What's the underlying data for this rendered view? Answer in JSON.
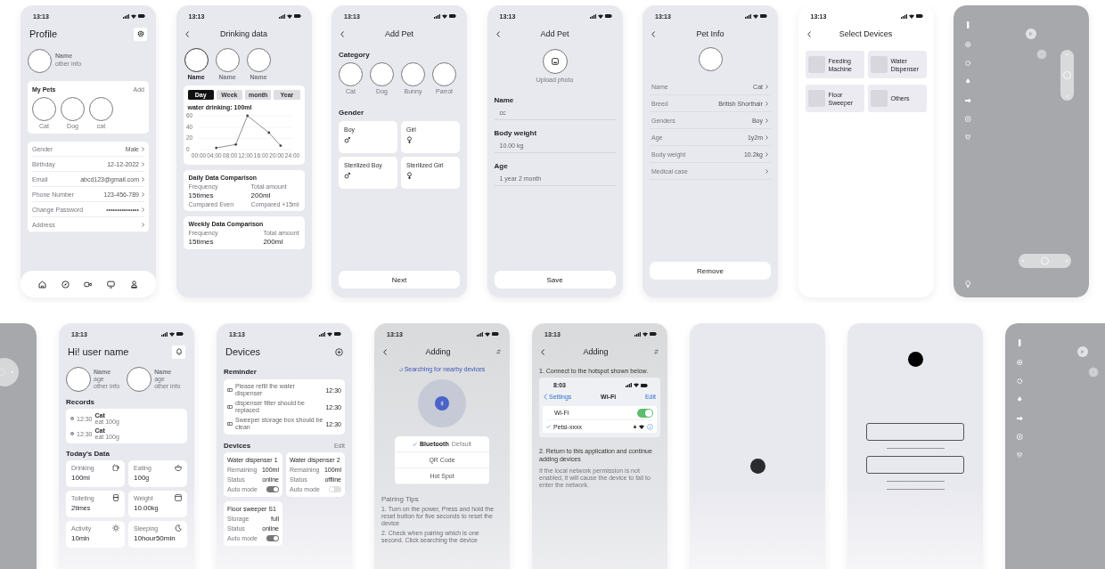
{
  "rows": [
    {
      "screens": [
        {
          "kind": "profile",
          "time": "13:13",
          "title": "Profile",
          "user": {
            "name": "Name",
            "info": "other info"
          },
          "pets": {
            "title": "My Pets",
            "action": "Add",
            "items": [
              "Cat",
              "Dog",
              "cat"
            ]
          },
          "fields": [
            {
              "label": "Gender",
              "value": "Male"
            },
            {
              "label": "Birthday",
              "value": "12-12-2022"
            },
            {
              "label": "Email",
              "value": "abcd123@gmail.com"
            },
            {
              "label": "Phone Number",
              "value": "123-456-789"
            },
            {
              "label": "Change Password",
              "value": "•••••••••••••••"
            },
            {
              "label": "Address"
            }
          ]
        },
        {
          "kind": "drinking",
          "time": "13:13",
          "title": "Drinking data",
          "pets": [
            {
              "name": "Name",
              "selected": true
            },
            {
              "name": "Name",
              "selected": false
            },
            {
              "name": "Name",
              "selected": false
            }
          ],
          "periods": [
            {
              "label": "Day",
              "selected": true
            },
            {
              "label": "Week",
              "selected": false
            },
            {
              "label": "month",
              "selected": false
            },
            {
              "label": "Year",
              "selected": false
            }
          ],
          "chart_data": {
            "type": "line",
            "title": "water drinking: 100ml",
            "x": [
              4.5,
              9.5,
              12.5,
              18,
              21
            ],
            "series": [
              {
                "color": "#444444",
                "values": [
                  3,
                  9,
                  60,
                  30,
                  7
                ]
              }
            ],
            "xlim": [
              0,
              24
            ],
            "ylim": [
              0,
              60
            ],
            "xticks": [
              {
                "value": 0,
                "label": "00:00"
              },
              {
                "value": 4,
                "label": "04:00"
              },
              {
                "value": 8,
                "label": "08:00"
              },
              {
                "value": 12,
                "label": "12:00"
              },
              {
                "value": 16,
                "label": "16:00"
              },
              {
                "value": 20,
                "label": "20:00"
              },
              {
                "value": 24,
                "label": "24:00"
              }
            ],
            "yticks": [
              0,
              20,
              40,
              60
            ]
          },
          "comparisons": [
            {
              "title": "Daily Data Comparison",
              "left_label": "Frequency",
              "left_value": "15times",
              "left_note": "Compared  Even",
              "right_label": "Total amount",
              "right_value": "200ml",
              "right_note": "Compared  +15ml"
            },
            {
              "title": "Weekly Data Comparison",
              "left_label": "Frequency",
              "left_value": "15times",
              "right_label": "Total amount",
              "right_value": "200ml"
            }
          ]
        },
        {
          "kind": "add_pet_category",
          "time": "13:13",
          "title": "Add Pet",
          "category_title": "Category",
          "categories": [
            "Cat",
            "Dog",
            "Bunny",
            "Parrot"
          ],
          "gender_title": "Gender",
          "genders": [
            {
              "label": "Boy",
              "kind": "male",
              "sterilized": false
            },
            {
              "label": "Girl",
              "kind": "female",
              "sterilized": false
            },
            {
              "label": "Sterilized Boy",
              "kind": "male",
              "sterilized": true
            },
            {
              "label": "Sterilized Girl",
              "kind": "female",
              "sterilized": true
            }
          ],
          "button": "Next"
        },
        {
          "kind": "add_pet_form",
          "time": "13:13",
          "title": "Add Pet",
          "upload": "Upload photo",
          "fields": [
            {
              "label": "Name",
              "value": "cc"
            },
            {
              "label": "Body weight",
              "value": "10.00 kg"
            },
            {
              "label": "Age",
              "value": "1 year 2 month"
            }
          ],
          "button": "Save"
        },
        {
          "kind": "pet_info",
          "time": "13:13",
          "title": "Pet Info",
          "rows": [
            {
              "label": "Name",
              "value": "Cat"
            },
            {
              "label": "Breed",
              "value": "British Shorthair"
            },
            {
              "label": "Genders",
              "value": "Boy"
            },
            {
              "label": "Age",
              "value": "1y2m"
            },
            {
              "label": "Body weight",
              "value": "10.2kg"
            },
            {
              "label": "Medical case"
            }
          ],
          "button": "Remove"
        },
        {
          "kind": "select_devices",
          "time": "13:13",
          "title": "Select Devices",
          "devices": [
            "Feeding Machine",
            "Water Dispenser",
            "Floor Sweeper",
            "Others"
          ]
        },
        {
          "kind": "control_panel"
        }
      ]
    },
    {
      "screens": [
        {
          "kind": "control_edge"
        },
        {
          "kind": "home",
          "time": "13:13",
          "title": "Hi! user name",
          "pets": [
            {
              "name": "Name",
              "age": "age",
              "info": "other info"
            },
            {
              "name": "Name",
              "age": "age",
              "info": "other info"
            }
          ],
          "records_title": "Records",
          "records": [
            {
              "time": "12:30",
              "name": "Cat",
              "note": "eat 100g"
            },
            {
              "time": "12:30",
              "name": "Cat",
              "note": "eat 100g"
            }
          ],
          "data_title": "Today's Data",
          "stats": [
            {
              "label": "Drinking",
              "value": "100",
              "unit": "ml"
            },
            {
              "label": "Eating",
              "value": "100",
              "unit": "g"
            },
            {
              "label": "Toileting",
              "value": "2",
              "unit": "times"
            },
            {
              "label": "Weight",
              "value": "10.00",
              "unit": "kg"
            },
            {
              "label": "Activity",
              "value": "10",
              "unit": "min"
            },
            {
              "label": "Sleeping",
              "value": "10hour50min"
            }
          ]
        },
        {
          "kind": "devices",
          "time": "13:13",
          "title": "Devices",
          "reminder_title": "Reminder",
          "reminders": [
            {
              "text": "Please refill the water dispenser",
              "time": "12:30"
            },
            {
              "text": "dispenser filter should be replaced",
              "time": "12:30"
            },
            {
              "text": "Sweeper storage box should be clean",
              "time": "12:30"
            }
          ],
          "devices_title": "Devices",
          "action": "Edit",
          "devices": [
            {
              "name": "Water dispenser 1",
              "rows": [
                {
                  "kind": "text",
                  "label": "Remaining",
                  "value": "100ml"
                },
                {
                  "kind": "text",
                  "label": "Status",
                  "value": "online"
                },
                {
                  "kind": "toggle",
                  "label": "Auto mode",
                  "on": true
                }
              ]
            },
            {
              "name": "Water dispenser 2",
              "rows": [
                {
                  "kind": "text",
                  "label": "Remaining",
                  "value": "100ml"
                },
                {
                  "kind": "text",
                  "label": "Status",
                  "value": "offline"
                },
                {
                  "kind": "toggle",
                  "label": "Auto mode",
                  "on": false
                }
              ]
            },
            {
              "name": "Floor sweeper S1",
              "rows": [
                {
                  "kind": "text",
                  "label": "Storage",
                  "value": "full"
                },
                {
                  "kind": "text",
                  "label": "Status",
                  "value": "online"
                },
                {
                  "kind": "toggle",
                  "label": "Auto mode",
                  "on": true
                }
              ]
            }
          ]
        },
        {
          "kind": "adding_bluetooth",
          "time": "13:13",
          "title": "Adding",
          "searching": "Searching for nearby devices",
          "methods": [
            {
              "label": "Bluetooth",
              "note": "Default",
              "selected": true
            },
            {
              "label": "QR Code",
              "selected": false
            },
            {
              "label": "Hot Spot",
              "selected": false
            }
          ],
          "tips_title": "Pairing Tips",
          "tips": [
            "1. Turn on the power, Press and hold the reset button for five seconds to reset the device",
            "2. Check when pairing which is one second. Click searching the device"
          ]
        },
        {
          "kind": "adding_hotspot",
          "time": "13:13",
          "title": "Adding",
          "step1": "1. Connect to the hotspot shown below.",
          "inner": {
            "time": "8:03",
            "back": "Settings",
            "title": "Wi-Fi",
            "action": "Edit",
            "wifi_label": "Wi-Fi",
            "wifi_on": true,
            "network": "Petsi-xxxx",
            "connected": true
          },
          "step2": "2. Return to this application and continue adding devices",
          "note": "If the local network permission is not enabled, it will cause the device to fail to enter the network."
        },
        {
          "kind": "splash"
        },
        {
          "kind": "wireframe"
        },
        {
          "kind": "control_panel"
        }
      ]
    }
  ]
}
